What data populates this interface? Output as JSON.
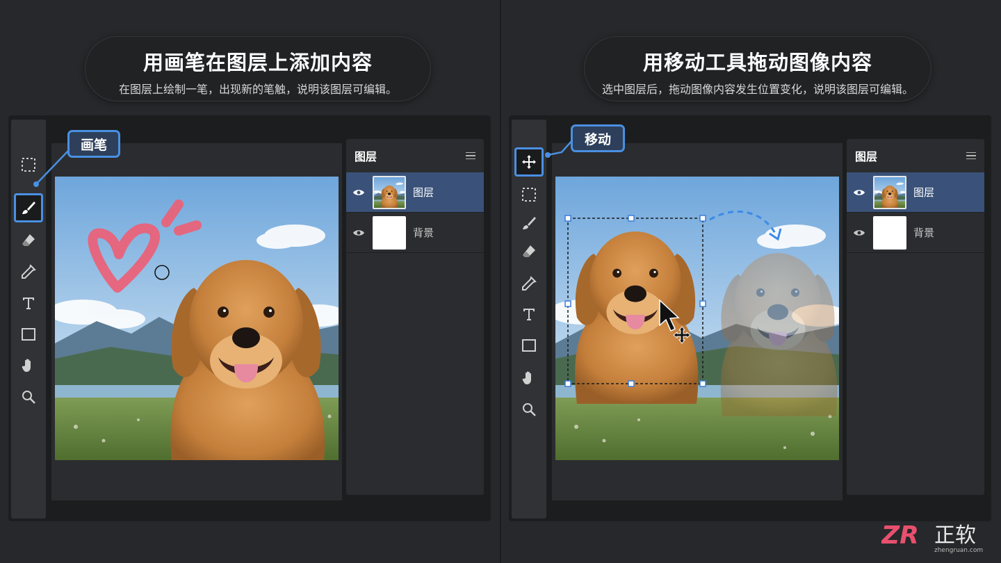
{
  "left": {
    "title": "用画笔在图层上添加内容",
    "subtitle": "在图层上绘制一笔，出现新的笔触，说明该图层可编辑。",
    "callout": "画笔",
    "active_tool": "brush-icon",
    "layers_title": "图层",
    "layers": [
      {
        "name": "图层",
        "selected": true,
        "thumb": "dog"
      },
      {
        "name": "背景",
        "selected": false,
        "thumb": "white"
      }
    ]
  },
  "right": {
    "title": "用移动工具拖动图像内容",
    "subtitle": "选中图层后，拖动图像内容发生位置变化，说明该图层可编辑。",
    "callout": "移动",
    "active_tool": "move-icon",
    "layers_title": "图层",
    "layers": [
      {
        "name": "图层",
        "selected": true,
        "thumb": "dog"
      },
      {
        "name": "背景",
        "selected": false,
        "thumb": "white"
      }
    ]
  },
  "tools_left": [
    "marquee-icon",
    "brush-icon",
    "eraser-icon",
    "eyedropper-icon",
    "text-icon",
    "rectangle-icon",
    "hand-icon",
    "zoom-icon"
  ],
  "tools_right": [
    "move-icon",
    "marquee-icon",
    "brush-icon",
    "eraser-icon",
    "eyedropper-icon",
    "text-icon",
    "rectangle-icon",
    "hand-icon",
    "zoom-icon"
  ],
  "logo": {
    "mark": "ZR",
    "text": "正软",
    "url": "zhengruan.com"
  },
  "colors": {
    "accent": "#4a90e2",
    "selected_layer": "#3a5279",
    "stroke_pink": "#e9637a"
  }
}
